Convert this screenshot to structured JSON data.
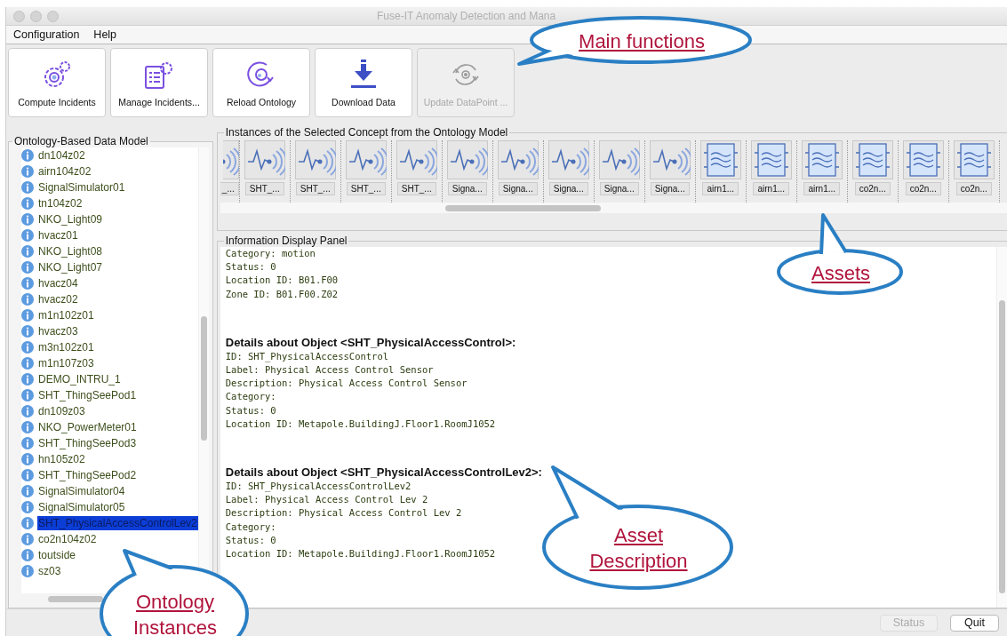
{
  "window": {
    "title": "Fuse-IT Anomaly Detection and Mana"
  },
  "menu": [
    "Configuration",
    "Help"
  ],
  "toolbar": [
    {
      "label": "Compute Incidents",
      "kind": "compute",
      "disabled": false
    },
    {
      "label": "Manage Incidents...",
      "kind": "manage",
      "disabled": false
    },
    {
      "label": "Reload Ontology",
      "kind": "reload",
      "disabled": false
    },
    {
      "label": "Download Data",
      "kind": "download",
      "disabled": false
    },
    {
      "label": "Update DataPoint ...",
      "kind": "update",
      "disabled": true
    }
  ],
  "ontology_panel": {
    "title": "Ontology-Based Data Model",
    "items": [
      {
        "label": "dn104z02",
        "selected": false
      },
      {
        "label": "airn104z02",
        "selected": false
      },
      {
        "label": "SignalSimulator01",
        "selected": false
      },
      {
        "label": "tn104z02",
        "selected": false
      },
      {
        "label": "NKO_Light09",
        "selected": false
      },
      {
        "label": "hvacz01",
        "selected": false
      },
      {
        "label": "NKO_Light08",
        "selected": false
      },
      {
        "label": "NKO_Light07",
        "selected": false
      },
      {
        "label": "hvacz04",
        "selected": false
      },
      {
        "label": "hvacz02",
        "selected": false
      },
      {
        "label": "m1n102z01",
        "selected": false
      },
      {
        "label": "hvacz03",
        "selected": false
      },
      {
        "label": "m3n102z01",
        "selected": false
      },
      {
        "label": "m1n107z03",
        "selected": false
      },
      {
        "label": "DEMO_INTRU_1",
        "selected": false
      },
      {
        "label": "SHT_ThingSeePod1",
        "selected": false
      },
      {
        "label": "dn109z03",
        "selected": false
      },
      {
        "label": "NKO_PowerMeter01",
        "selected": false
      },
      {
        "label": "SHT_ThingSeePod3",
        "selected": false
      },
      {
        "label": "hn105z02",
        "selected": false
      },
      {
        "label": "SHT_ThingSeePod2",
        "selected": false
      },
      {
        "label": "SignalSimulator04",
        "selected": false
      },
      {
        "label": "SignalSimulator05",
        "selected": false
      },
      {
        "label": "SHT_PhysicalAccessControlLev2",
        "selected": true
      },
      {
        "label": "co2n104z02",
        "selected": false
      },
      {
        "label": "toutside",
        "selected": false
      },
      {
        "label": "sz03",
        "selected": false
      }
    ]
  },
  "instances_panel": {
    "title": "Instances of the Selected Concept from the Ontology Model",
    "items": [
      {
        "label": "_...",
        "kind": "signal"
      },
      {
        "label": "SHT_...",
        "kind": "signal"
      },
      {
        "label": "SHT_...",
        "kind": "signal"
      },
      {
        "label": "SHT_...",
        "kind": "signal"
      },
      {
        "label": "SHT_...",
        "kind": "signal"
      },
      {
        "label": "Signa...",
        "kind": "signal"
      },
      {
        "label": "Signa...",
        "kind": "signal"
      },
      {
        "label": "Signa...",
        "kind": "signal"
      },
      {
        "label": "Signa...",
        "kind": "signal"
      },
      {
        "label": "Signa...",
        "kind": "signal"
      },
      {
        "label": "airn1...",
        "kind": "air"
      },
      {
        "label": "airn1...",
        "kind": "air"
      },
      {
        "label": "airn1...",
        "kind": "air"
      },
      {
        "label": "co2n...",
        "kind": "air"
      },
      {
        "label": "co2n...",
        "kind": "air"
      },
      {
        "label": "co2n...",
        "kind": "air"
      }
    ]
  },
  "info_panel": {
    "title": "Information Display Panel",
    "blocks": [
      {
        "lines": [
          "Category: motion",
          "Status: 0",
          "Location ID: B01.F00",
          "Zone ID: B01.F00.Z02"
        ]
      },
      {
        "heading": "Details about Object <SHT_PhysicalAccessControl>:",
        "lines": [
          "ID: SHT_PhysicalAccessControl",
          "Label: Physical Access Control Sensor",
          "Description: Physical Access Control Sensor",
          "Category:",
          "Status: 0",
          "Location ID: Metapole.BuildingJ.Floor1.RoomJ1052"
        ]
      },
      {
        "heading": "Details about Object <SHT_PhysicalAccessControlLev2>:",
        "lines": [
          "ID: SHT_PhysicalAccessControlLev2",
          "Label: Physical Access Control Lev 2",
          "Description: Physical Access Control Lev 2",
          "Category:",
          "Status: 0",
          "Location ID: Metapole.BuildingJ.Floor1.RoomJ1052"
        ]
      }
    ]
  },
  "bottom_buttons": [
    {
      "label": "Status",
      "disabled": true
    },
    {
      "label": "Quit",
      "disabled": false
    }
  ],
  "annotations": [
    {
      "lines": [
        "Main functions"
      ]
    },
    {
      "lines": [
        "Assets"
      ]
    },
    {
      "lines": [
        "Asset",
        "Description"
      ]
    },
    {
      "lines": [
        "Ontology",
        "Instances"
      ]
    }
  ]
}
